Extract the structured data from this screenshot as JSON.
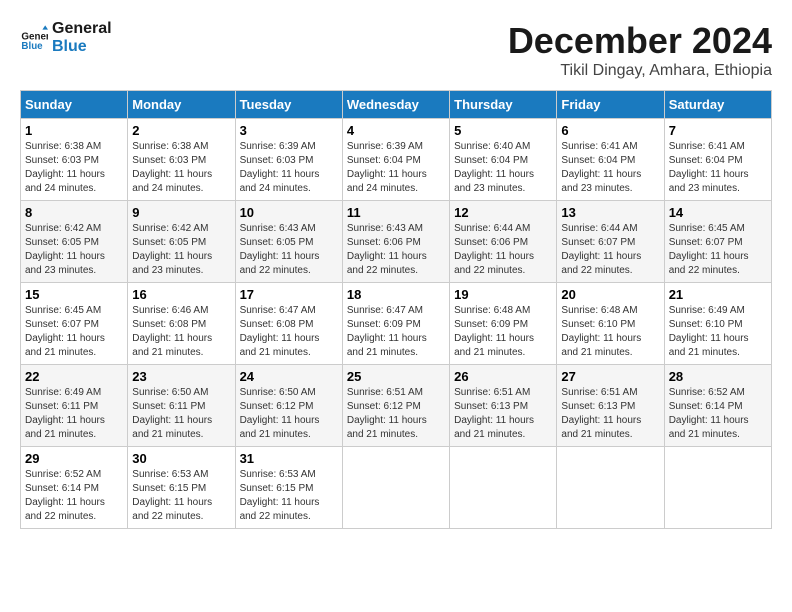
{
  "logo": {
    "line1": "General",
    "line2": "Blue"
  },
  "title": "December 2024",
  "subtitle": "Tikil Dingay, Amhara, Ethiopia",
  "days_header": [
    "Sunday",
    "Monday",
    "Tuesday",
    "Wednesday",
    "Thursday",
    "Friday",
    "Saturday"
  ],
  "weeks": [
    [
      {
        "day": "1",
        "sunrise": "6:38 AM",
        "sunset": "6:03 PM",
        "daylight": "11 hours and 24 minutes."
      },
      {
        "day": "2",
        "sunrise": "6:38 AM",
        "sunset": "6:03 PM",
        "daylight": "11 hours and 24 minutes."
      },
      {
        "day": "3",
        "sunrise": "6:39 AM",
        "sunset": "6:03 PM",
        "daylight": "11 hours and 24 minutes."
      },
      {
        "day": "4",
        "sunrise": "6:39 AM",
        "sunset": "6:04 PM",
        "daylight": "11 hours and 24 minutes."
      },
      {
        "day": "5",
        "sunrise": "6:40 AM",
        "sunset": "6:04 PM",
        "daylight": "11 hours and 23 minutes."
      },
      {
        "day": "6",
        "sunrise": "6:41 AM",
        "sunset": "6:04 PM",
        "daylight": "11 hours and 23 minutes."
      },
      {
        "day": "7",
        "sunrise": "6:41 AM",
        "sunset": "6:04 PM",
        "daylight": "11 hours and 23 minutes."
      }
    ],
    [
      {
        "day": "8",
        "sunrise": "6:42 AM",
        "sunset": "6:05 PM",
        "daylight": "11 hours and 23 minutes."
      },
      {
        "day": "9",
        "sunrise": "6:42 AM",
        "sunset": "6:05 PM",
        "daylight": "11 hours and 23 minutes."
      },
      {
        "day": "10",
        "sunrise": "6:43 AM",
        "sunset": "6:05 PM",
        "daylight": "11 hours and 22 minutes."
      },
      {
        "day": "11",
        "sunrise": "6:43 AM",
        "sunset": "6:06 PM",
        "daylight": "11 hours and 22 minutes."
      },
      {
        "day": "12",
        "sunrise": "6:44 AM",
        "sunset": "6:06 PM",
        "daylight": "11 hours and 22 minutes."
      },
      {
        "day": "13",
        "sunrise": "6:44 AM",
        "sunset": "6:07 PM",
        "daylight": "11 hours and 22 minutes."
      },
      {
        "day": "14",
        "sunrise": "6:45 AM",
        "sunset": "6:07 PM",
        "daylight": "11 hours and 22 minutes."
      }
    ],
    [
      {
        "day": "15",
        "sunrise": "6:45 AM",
        "sunset": "6:07 PM",
        "daylight": "11 hours and 21 minutes."
      },
      {
        "day": "16",
        "sunrise": "6:46 AM",
        "sunset": "6:08 PM",
        "daylight": "11 hours and 21 minutes."
      },
      {
        "day": "17",
        "sunrise": "6:47 AM",
        "sunset": "6:08 PM",
        "daylight": "11 hours and 21 minutes."
      },
      {
        "day": "18",
        "sunrise": "6:47 AM",
        "sunset": "6:09 PM",
        "daylight": "11 hours and 21 minutes."
      },
      {
        "day": "19",
        "sunrise": "6:48 AM",
        "sunset": "6:09 PM",
        "daylight": "11 hours and 21 minutes."
      },
      {
        "day": "20",
        "sunrise": "6:48 AM",
        "sunset": "6:10 PM",
        "daylight": "11 hours and 21 minutes."
      },
      {
        "day": "21",
        "sunrise": "6:49 AM",
        "sunset": "6:10 PM",
        "daylight": "11 hours and 21 minutes."
      }
    ],
    [
      {
        "day": "22",
        "sunrise": "6:49 AM",
        "sunset": "6:11 PM",
        "daylight": "11 hours and 21 minutes."
      },
      {
        "day": "23",
        "sunrise": "6:50 AM",
        "sunset": "6:11 PM",
        "daylight": "11 hours and 21 minutes."
      },
      {
        "day": "24",
        "sunrise": "6:50 AM",
        "sunset": "6:12 PM",
        "daylight": "11 hours and 21 minutes."
      },
      {
        "day": "25",
        "sunrise": "6:51 AM",
        "sunset": "6:12 PM",
        "daylight": "11 hours and 21 minutes."
      },
      {
        "day": "26",
        "sunrise": "6:51 AM",
        "sunset": "6:13 PM",
        "daylight": "11 hours and 21 minutes."
      },
      {
        "day": "27",
        "sunrise": "6:51 AM",
        "sunset": "6:13 PM",
        "daylight": "11 hours and 21 minutes."
      },
      {
        "day": "28",
        "sunrise": "6:52 AM",
        "sunset": "6:14 PM",
        "daylight": "11 hours and 21 minutes."
      }
    ],
    [
      {
        "day": "29",
        "sunrise": "6:52 AM",
        "sunset": "6:14 PM",
        "daylight": "11 hours and 22 minutes."
      },
      {
        "day": "30",
        "sunrise": "6:53 AM",
        "sunset": "6:15 PM",
        "daylight": "11 hours and 22 minutes."
      },
      {
        "day": "31",
        "sunrise": "6:53 AM",
        "sunset": "6:15 PM",
        "daylight": "11 hours and 22 minutes."
      },
      null,
      null,
      null,
      null
    ]
  ]
}
